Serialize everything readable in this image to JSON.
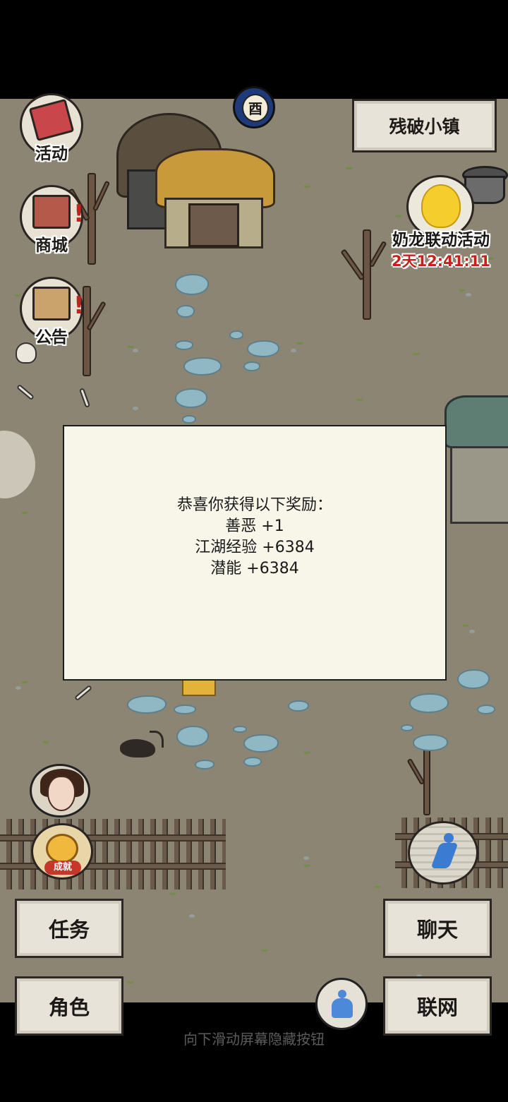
{
  "location": {
    "name": "残破小镇"
  },
  "left_menu": {
    "activity_label": "活动",
    "shop_label": "商城",
    "notice_label": "公告"
  },
  "time_badge": {
    "glyph": "酉"
  },
  "event": {
    "title": "奶龙联动活动",
    "timer": "2天12:41:11"
  },
  "reward_popup": {
    "heading": "恭喜你获得以下奖励：",
    "lines": [
      "善恶 +1",
      "江湖经验 +6384",
      "潜能 +6384"
    ]
  },
  "achievement": {
    "label": "成就"
  },
  "buttons": {
    "task": "任务",
    "chat": "聊天",
    "role": "角色",
    "network": "联网"
  },
  "hint": "向下滑动屏幕隐藏按钮",
  "colors": {
    "ground": "#8d8574",
    "stone": "#8fb7c4",
    "timer_red": "#c8201c",
    "popup_bg": "#f8f5e9",
    "button_bg": "#e7e3d8"
  }
}
